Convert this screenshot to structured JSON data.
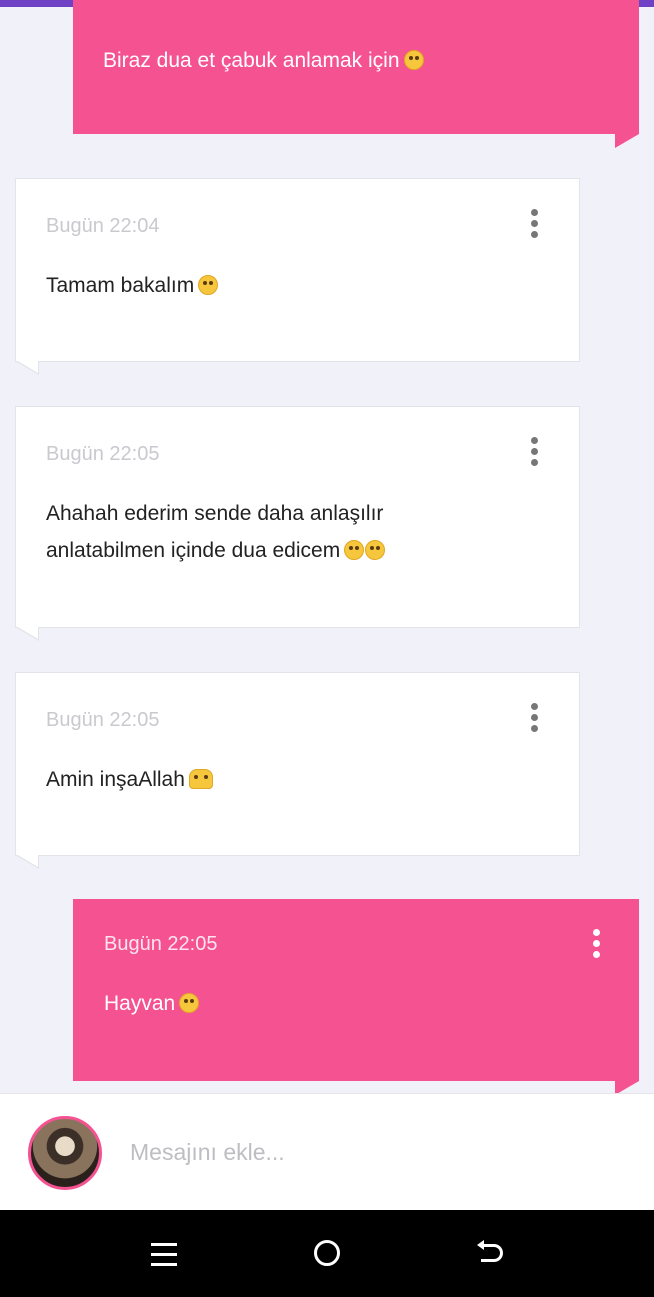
{
  "colors": {
    "accent_top": "#6f41c4",
    "outgoing_bubble": "#f55292",
    "incoming_bubble": "#ffffff",
    "background": "#f1f1f9"
  },
  "messages": [
    {
      "direction": "outgoing",
      "time": "",
      "text": "Biraz dua et çabuk anlamak için",
      "emoji": "rolling-eyes-emoji"
    },
    {
      "direction": "incoming",
      "time": "Bugün 22:04",
      "text": "Tamam bakalım",
      "emoji": "smiling-emoji"
    },
    {
      "direction": "incoming",
      "time": "Bugün 22:05",
      "text": "Ahahah ederim sende daha anlaşılır anlatabilmen içinde dua edicem",
      "emoji": "laughing-tears-emoji"
    },
    {
      "direction": "incoming",
      "time": "Bugün 22:05",
      "text": "Amin inşaAllah",
      "emoji": "raised-hands-emoji"
    },
    {
      "direction": "outgoing",
      "time": "Bugün 22:05",
      "text": "Hayvan",
      "emoji": "rolling-eyes-emoji"
    }
  ],
  "composer": {
    "placeholder": "Mesajını ekle...",
    "value": ""
  },
  "navbar": {
    "menu_icon": "menu-icon",
    "home_icon": "home-icon",
    "back_icon": "back-icon"
  }
}
